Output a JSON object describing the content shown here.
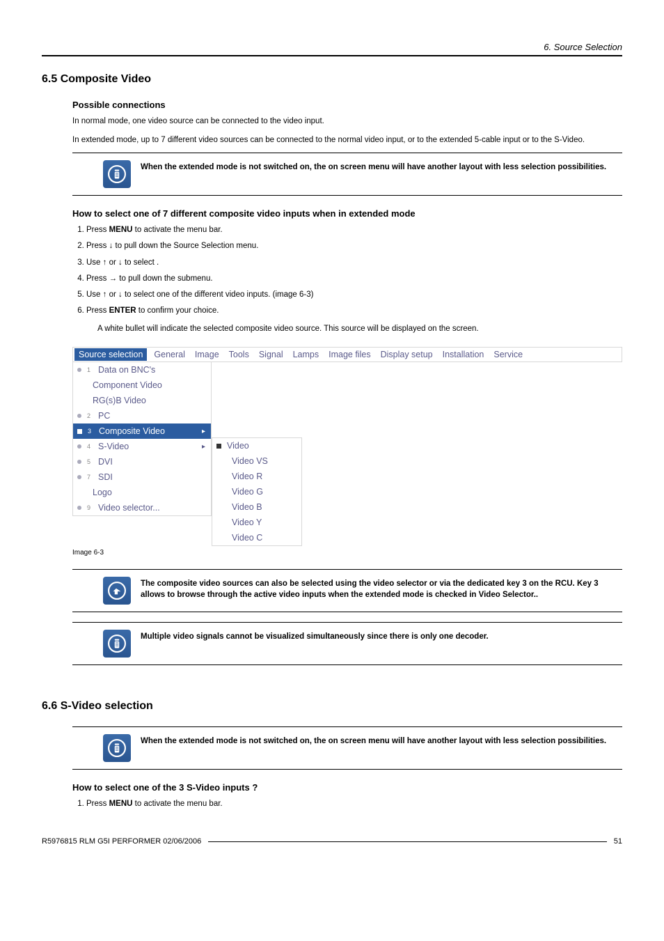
{
  "header": {
    "chapter": "6. Source Selection"
  },
  "section65": {
    "number_title": "6.5   Composite Video",
    "sub1": "Possible connections",
    "p1": "In normal mode, one video source can be connected to the video input.",
    "p2": "In extended mode, up to 7 different video sources can be connected to the normal video input, or to the extended 5-cable input or to the S-Video.",
    "callout1": "When the extended mode is not switched on, the on screen menu will have another layout with less selection possibilities.",
    "sub2": "How to select one of 7 different composite video inputs when in extended mode",
    "steps": [
      "Press MENU to activate the menu bar.",
      "Press ↓ to pull down the Source Selection menu.",
      "Use ↑ or ↓ to select                            .",
      "Press → to pull down the submenu.",
      "Use ↑ or ↓ to select one of the different video inputs. (image 6-3)",
      "Press ENTER to confirm your choice."
    ],
    "note_after_steps": "A white bullet will indicate the selected composite video source. This source will be displayed on the screen.",
    "caption": "Image 6-3",
    "callout2": "The composite video sources can also be selected using the video selector or via the dedicated key 3 on the RCU. Key 3 allows to browse through the active video inputs when the extended mode is checked in Video Selector..",
    "callout3": "Multiple video signals cannot be visualized simultaneously since there is only one decoder."
  },
  "menu": {
    "bar": [
      "Source selection",
      "General",
      "Image",
      "Tools",
      "Signal",
      "Lamps",
      "Image files",
      "Display setup",
      "Installation",
      "Service"
    ],
    "main": [
      {
        "num": "1",
        "label": "Data on BNC's"
      },
      {
        "num": "",
        "label": "Component Video"
      },
      {
        "num": "",
        "label": "RG(s)B Video"
      },
      {
        "num": "2",
        "label": "PC"
      },
      {
        "num": "3",
        "label": "Composite Video",
        "highlight": true,
        "arrow": true,
        "square": true
      },
      {
        "num": "4",
        "label": "S-Video",
        "arrow": true
      },
      {
        "num": "5",
        "label": "DVI"
      },
      {
        "num": "7",
        "label": "SDI"
      },
      {
        "num": "",
        "label": "Logo"
      },
      {
        "num": "9",
        "label": "Video selector..."
      }
    ],
    "sub": [
      "Video",
      "Video VS",
      "Video R",
      "Video G",
      "Video B",
      "Video Y",
      "Video C"
    ]
  },
  "section66": {
    "number_title": "6.6   S-Video selection",
    "callout1": "When the extended mode is not switched on, the on screen menu will have another layout with less selection possibilities.",
    "sub1": "How to select one of the 3 S-Video inputs ?",
    "steps": [
      "Press MENU to activate the menu bar."
    ]
  },
  "footer": {
    "left": "R5976815  RLM G5I PERFORMER  02/06/2006",
    "right": "51"
  }
}
